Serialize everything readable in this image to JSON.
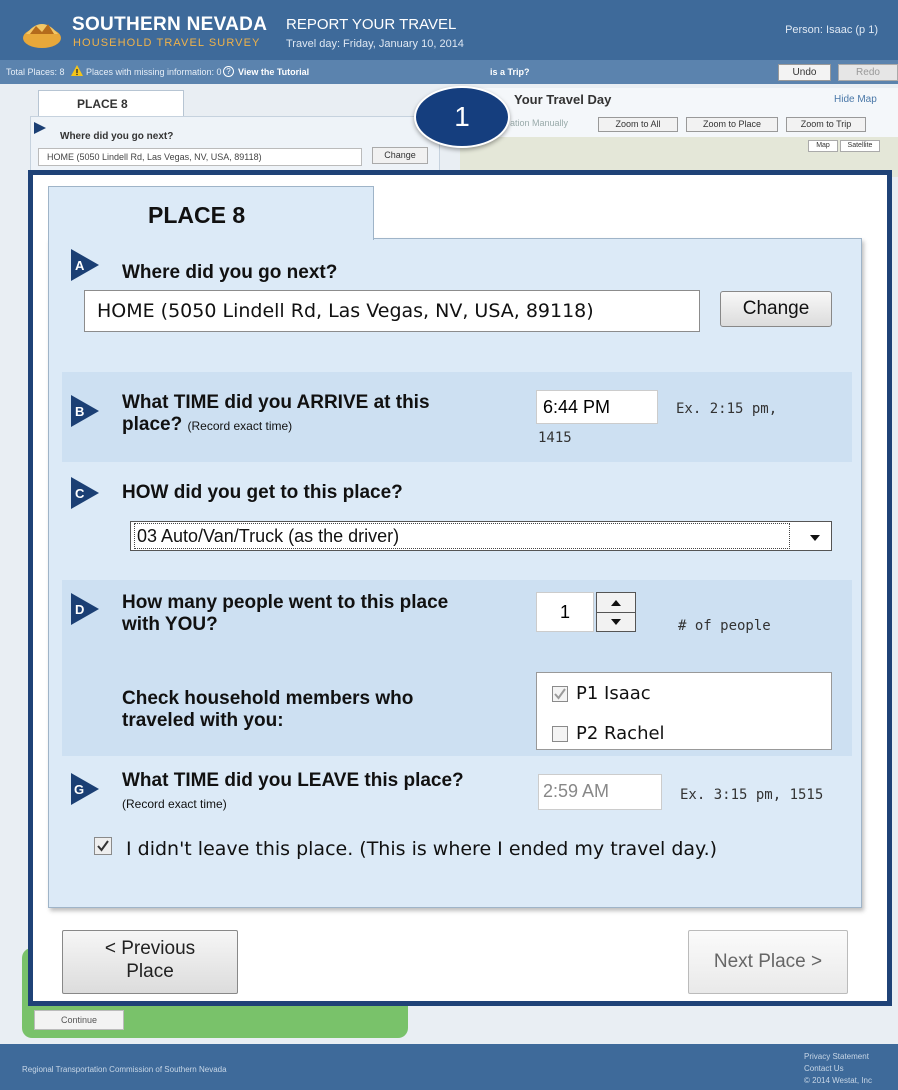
{
  "header": {
    "brand_name": "SOUTHERN NEVADA",
    "brand_sub": "HOUSEHOLD TRAVEL SURVEY",
    "report_title": "REPORT YOUR TRAVEL",
    "travel_day": "Travel day:  Friday, January 10, 2014",
    "person": "Person: Isaac (p 1)"
  },
  "toolbar": {
    "total_places": "Total Places: 8",
    "missing_info": "Places with missing information: 0",
    "tutorial": "View the Tutorial",
    "trip": "is a Trip?",
    "undo": "Undo",
    "redo": "Redo"
  },
  "background": {
    "place_tab": "PLACE 8",
    "question_a": "Where did you go next?",
    "address": "HOME (5050 Lindell Rd, Las Vegas, NV, USA, 89118)",
    "change": "Change",
    "map_title": "Your Travel Day",
    "hide_map": "Hide Map",
    "locate_manually": "ation Manually",
    "zoom_all": "Zoom to All",
    "zoom_place": "Zoom to Place",
    "zoom_trip": "Zoom to Trip",
    "map_btn": "Map",
    "satellite_btn": "Satellite",
    "continue": "Continue"
  },
  "badge": {
    "number": "1"
  },
  "form": {
    "place_title": "PLACE 8",
    "q_a": "Where did you go next?",
    "address_value": "HOME (5050 Lindell Rd, Las Vegas, NV, USA, 89118)",
    "change_label": "Change",
    "q_b_line1": "What TIME did you ARRIVE at this",
    "q_b_line2": "place?",
    "q_b_note": "(Record exact time)",
    "arrive_time": "6:44 PM",
    "arrive_hint_1": "Ex. 2:15 pm,",
    "arrive_hint_2": "1415",
    "q_c": "HOW did you get to this place?",
    "mode_value": "03 Auto/Van/Truck (as the driver)",
    "q_d_line1": "How many people went to this place",
    "q_d_line2": "with YOU?",
    "people_count": "1",
    "people_hint": "# of people",
    "q_members_line1": "Check household members who",
    "q_members_line2": "traveled with you:",
    "members": [
      {
        "label": "P1 Isaac",
        "checked": true,
        "disabled": true
      },
      {
        "label": "P2 Rachel",
        "checked": false,
        "disabled": false
      }
    ],
    "q_g": "What TIME did you LEAVE this place?",
    "q_g_note": "(Record exact time)",
    "leave_time": "2:59 AM",
    "leave_hint": "Ex. 3:15 pm, 1515",
    "final_place_label": "I didn't leave this place. (This is where I ended my travel day.)",
    "final_place_checked": true,
    "prev_line1": "< Previous",
    "prev_line2": "Place",
    "next_label": "Next Place >"
  },
  "footer": {
    "org": "Regional Transportation Commission of Southern Nevada",
    "privacy": "Privacy Statement",
    "contact": "Contact Us",
    "copyright": "© 2014 Westat, Inc"
  },
  "colors": {
    "header_blue": "#3e6a9a",
    "toolbar_blue": "#5b83ae",
    "overlay_border": "#1f4277",
    "badge": "#153e7e",
    "panel": "#dceaf7",
    "highlight_row": "#cde0f2",
    "arrow": "#1b3f74",
    "continue_green": "#79c26a"
  },
  "icons": {
    "logo": "survey-logo-icon",
    "warning": "warning-icon",
    "help": "help-icon",
    "step_arrow": "step-arrow-icon",
    "dropdown": "chevron-down-icon",
    "spinner": "spinner-icon"
  }
}
